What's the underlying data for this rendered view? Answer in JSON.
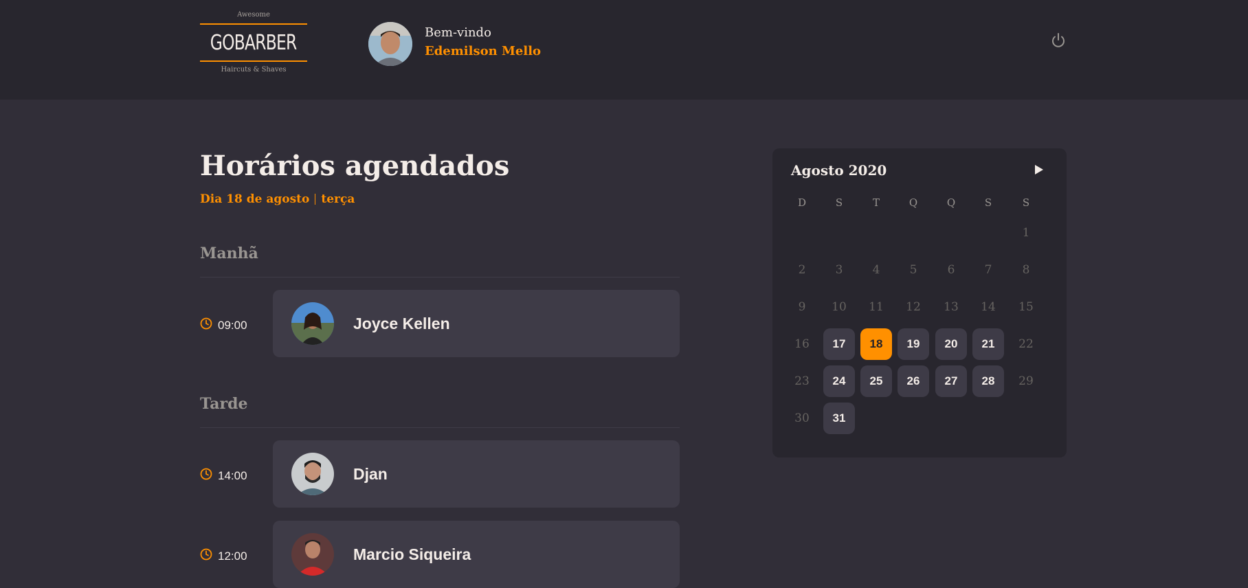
{
  "header": {
    "logo_top": "Awesome",
    "logo_brand": "GOBARBER",
    "logo_bottom": "Haircuts & Shaves",
    "welcome": "Bem-vindo",
    "user_name": "Edemilson Mello",
    "power_icon": "power-icon"
  },
  "main": {
    "title": "Horários agendados",
    "date_label": "Dia 18 de agosto",
    "weekday_label": "terça",
    "sections": [
      {
        "label": "Manhã",
        "appointments": [
          {
            "time": "09:00",
            "name": "Joyce Kellen"
          }
        ]
      },
      {
        "label": "Tarde",
        "appointments": [
          {
            "time": "14:00",
            "name": "Djan"
          },
          {
            "time": "12:00",
            "name": "Marcio Siqueira"
          }
        ]
      }
    ]
  },
  "calendar": {
    "month": "Agosto 2020",
    "weekdays": [
      "D",
      "S",
      "T",
      "Q",
      "Q",
      "S",
      "S"
    ],
    "first_weekday_index": 6,
    "days_in_month": 31,
    "available_days": [
      17,
      19,
      20,
      21,
      24,
      25,
      26,
      27,
      28,
      31
    ],
    "selected_day": 18
  },
  "colors": {
    "accent": "#ff9000",
    "background": "#312e38",
    "header_bg": "#28262e",
    "card_bg": "#3e3b47",
    "text": "#f4ede8",
    "muted": "#999591"
  }
}
